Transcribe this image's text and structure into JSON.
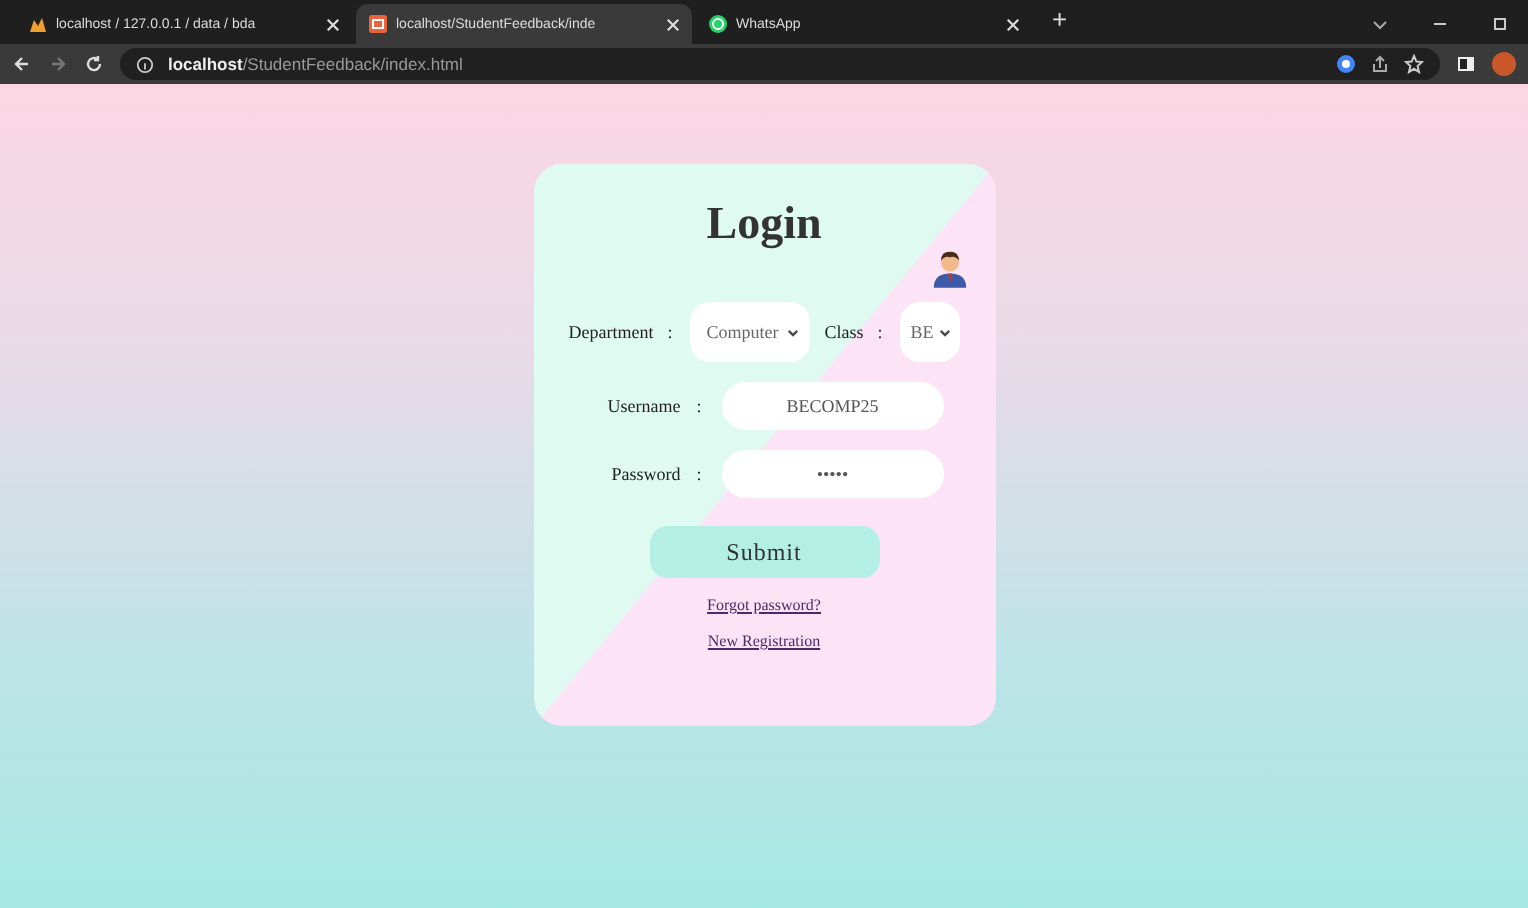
{
  "browser": {
    "tabs": [
      {
        "title": "localhost / 127.0.0.1 / data / bda",
        "selected": false
      },
      {
        "title": "localhost/StudentFeedback/inde",
        "selected": true
      },
      {
        "title": "WhatsApp",
        "selected": false
      }
    ],
    "new_tab": "+",
    "url_host": "localhost",
    "url_path": "/StudentFeedback/index.html"
  },
  "login": {
    "title": "Login",
    "department": {
      "label": "Department",
      "separator": ":",
      "value": "Computer"
    },
    "class": {
      "label": "Class",
      "separator": ":",
      "value": "BE"
    },
    "username": {
      "label": "Username",
      "separator": ":",
      "value": "BECOMP25"
    },
    "password": {
      "label": "Password",
      "separator": ":",
      "value": "•••••"
    },
    "submit": "Submit",
    "links": [
      "Forgot password?",
      "New Registration"
    ]
  }
}
